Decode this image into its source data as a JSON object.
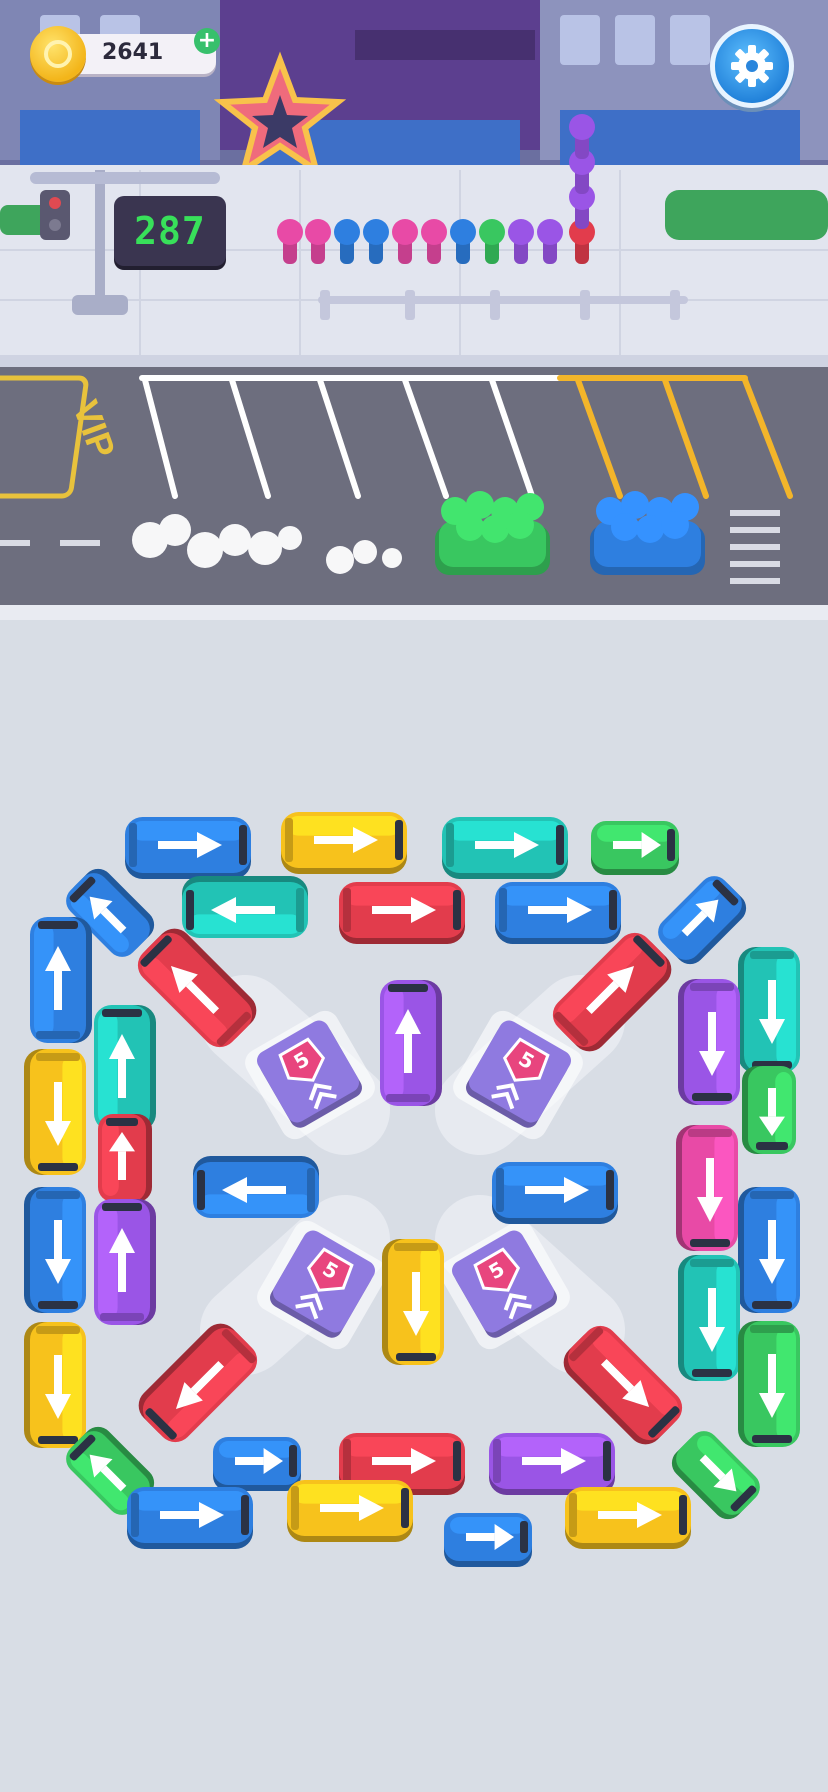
{
  "hud": {
    "coins": "2641",
    "coin_add": "+",
    "timer": "287",
    "settings_icon": "gear-icon"
  },
  "parking": {
    "vip_label": "VIP"
  },
  "colors": {
    "blue": "#2e7fe0",
    "yellow": "#f7c21c",
    "teal": "#22c3b5",
    "green": "#39c760",
    "red": "#e23c4c",
    "purple": "#9a55e6",
    "pink": "#e84aa6",
    "helipad": "#8f7ae0",
    "badge": "#e8457e"
  },
  "queue_passengers": [
    "pink",
    "pink",
    "blue",
    "blue",
    "pink",
    "pink",
    "blue",
    "green",
    "purple",
    "purple",
    "red",
    "purple",
    "purple",
    "purple"
  ],
  "spots": [
    {
      "label": "5",
      "icon": "chevron-up-icon"
    },
    {
      "label": "5",
      "icon": "chevron-up-icon"
    },
    {
      "label": "5",
      "icon": "chevron-up-icon"
    },
    {
      "label": "5",
      "icon": "chevron-up-icon"
    }
  ],
  "vehicles": [
    {
      "color": "blue",
      "type": "bus",
      "dir": "right"
    },
    {
      "color": "yellow",
      "type": "bus",
      "dir": "right"
    },
    {
      "color": "teal",
      "type": "bus",
      "dir": "right"
    },
    {
      "color": "green",
      "type": "car",
      "dir": "right"
    },
    {
      "color": "blue",
      "type": "car",
      "dir": "up-left"
    },
    {
      "color": "teal",
      "type": "bus",
      "dir": "left"
    },
    {
      "color": "red",
      "type": "bus",
      "dir": "right"
    },
    {
      "color": "blue",
      "type": "bus",
      "dir": "right"
    },
    {
      "color": "blue",
      "type": "car",
      "dir": "up-right"
    },
    {
      "color": "blue",
      "type": "bus",
      "dir": "up"
    },
    {
      "color": "red",
      "type": "bus",
      "dir": "up-left"
    },
    {
      "color": "purple",
      "type": "bus",
      "dir": "up"
    },
    {
      "color": "red",
      "type": "bus",
      "dir": "up-right"
    },
    {
      "color": "teal",
      "type": "bus",
      "dir": "down"
    },
    {
      "color": "teal",
      "type": "bus",
      "dir": "up"
    },
    {
      "color": "purple",
      "type": "bus",
      "dir": "down"
    },
    {
      "color": "yellow",
      "type": "bus",
      "dir": "down"
    },
    {
      "color": "green",
      "type": "car",
      "dir": "down"
    },
    {
      "color": "red",
      "type": "car",
      "dir": "up"
    },
    {
      "color": "blue",
      "type": "bus",
      "dir": "left"
    },
    {
      "color": "blue",
      "type": "bus",
      "dir": "right"
    },
    {
      "color": "pink",
      "type": "bus",
      "dir": "down"
    },
    {
      "color": "blue",
      "type": "bus",
      "dir": "down"
    },
    {
      "color": "blue",
      "type": "bus",
      "dir": "down"
    },
    {
      "color": "purple",
      "type": "bus",
      "dir": "up"
    },
    {
      "color": "yellow",
      "type": "bus",
      "dir": "down"
    },
    {
      "color": "teal",
      "type": "bus",
      "dir": "down"
    },
    {
      "color": "green",
      "type": "bus",
      "dir": "down"
    },
    {
      "color": "yellow",
      "type": "bus",
      "dir": "down"
    },
    {
      "color": "red",
      "type": "bus",
      "dir": "down-left"
    },
    {
      "color": "red",
      "type": "bus",
      "dir": "down-right"
    },
    {
      "color": "green",
      "type": "car",
      "dir": "up-left"
    },
    {
      "color": "blue",
      "type": "car",
      "dir": "right"
    },
    {
      "color": "red",
      "type": "bus",
      "dir": "right"
    },
    {
      "color": "purple",
      "type": "bus",
      "dir": "right"
    },
    {
      "color": "green",
      "type": "car",
      "dir": "down-right"
    },
    {
      "color": "blue",
      "type": "bus",
      "dir": "right"
    },
    {
      "color": "yellow",
      "type": "bus",
      "dir": "right"
    },
    {
      "color": "blue",
      "type": "car",
      "dir": "right"
    },
    {
      "color": "yellow",
      "type": "bus",
      "dir": "right"
    }
  ],
  "road_cars": [
    {
      "color": "green",
      "state": "loaded"
    },
    {
      "color": "blue",
      "state": "loaded"
    }
  ]
}
